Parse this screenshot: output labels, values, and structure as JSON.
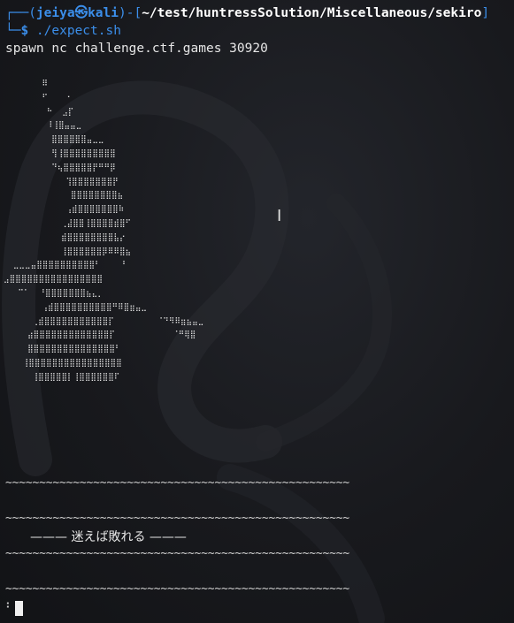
{
  "prompt": {
    "box_top": "┌──(",
    "user": "jeiya",
    "at_symbol": "㉿",
    "host": "kali",
    "mid": ")-[",
    "path": "~/test/huntressSolution/Miscellaneous/sekiro",
    "close": "]",
    "box_bottom": "└─",
    "dollar": "$",
    "command": " ./expect.sh"
  },
  "output": {
    "spawn_line": "spawn nc challenge.ctf.games 30920",
    "ascii_art": "        ⠿\n        ⠋    ⠂\n         ⠓  ⣠⡏\n         ⠸⢸⣿⣤⣤⣀\n          ⣿⣿⣿⣿⣿⣿⣤⣀⣀\n          ⢻⢸⣿⣿⣿⣿⣿⣿⣿⣿⣿\n          ⠙⢦⣿⣿⣿⣿⣿⡟⠛⠛⡿\n             ⢹⣿⣿⣿⣿⣿⣿⣿⡟\n              ⣿⣿⣿⣿⣿⣿⣿⣿⣦\n             ⢠⣾⣿⣿⣿⣿⣿⣿⣿⠷\n            ⢀⣼⣿⣿⢸⣿⣿⣿⣿⣾⣿⠋\n            ⣾⣿⣿⣿⣿⣿⣿⣿⣿⣧⡔\n            ⢸⣿⣿⣿⣿⣿⣿⡿⠿⠿⣿⣦\n  ⣀⣀⣀⣤⣿⣿⣿⣿⣿⣿⣿⣿⣿⣿⠃    ⠘\n⣠⣿⣿⣿⣿⣿⣿⣿⣿⣿⣿⣿⣿⣿⣿⣿⣿\n   ⠉⠁  ⠘⣿⣿⣿⣿⣿⣿⣿⣦⣄⡀\n        ⢠⣾⣿⣿⣿⣿⣿⣿⣿⣿⣿⣿⠛⠿⣿⣶⣤⣀\n      ⢀⣾⣿⣿⣿⣿⣿⣿⣿⣿⣿⣿⣿⡏         ⠈⠙⠻⠿⣶⣦⣤⣀\n     ⣴⣿⣿⣿⣿⣿⣿⣿⣿⣿⣿⣿⣿⣿⡏            ⠈⠛⢿⣿\n     ⣿⣿⣿⣿⣿⣿⣿⣿⣿⣿⣿⣿⣿⣿⣿⠃\n    ⢸⣿⣿⣿⣿⣿⣿⣿⣿⣿⣿⣿⣿⣿⣿⣿⣿\n      ⢸⣿⣿⣿⣿⣿⡇⢸⣿⣿⣿⣿⣿⣿⠏",
    "tilde_line": "~~~~~~~~~~~~~~~~~~~~~~~~~~~~~~~~~~~~~~~~~~~~~~~~~~~",
    "japanese_banner": "——— 迷えば敗れる ———",
    "input_prefix": "⠃"
  }
}
